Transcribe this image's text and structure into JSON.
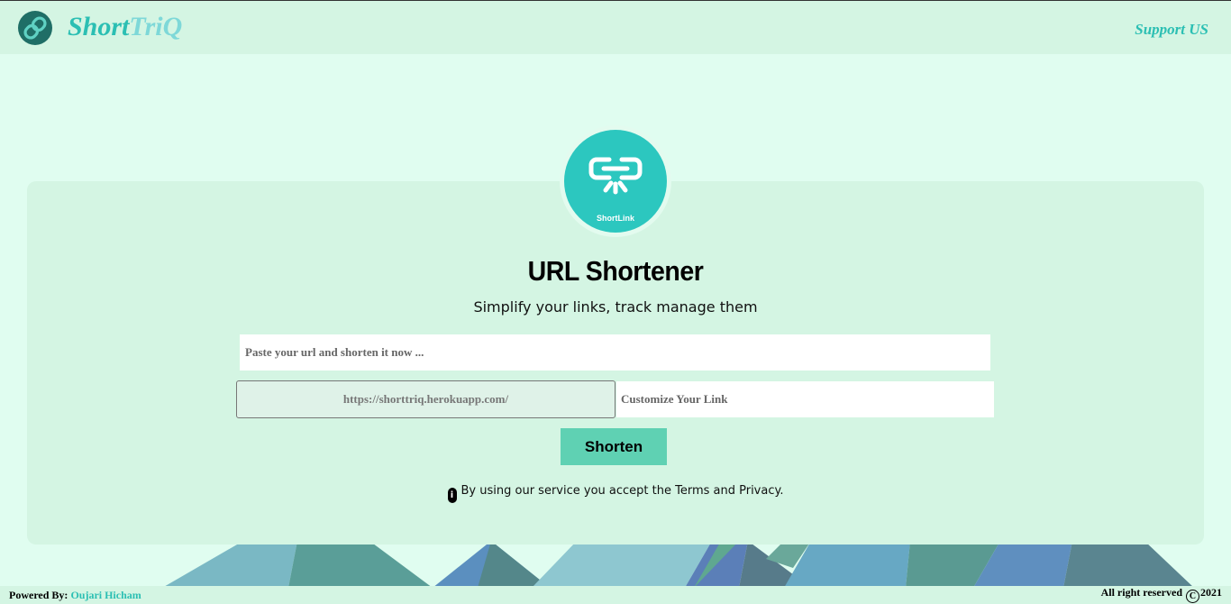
{
  "header": {
    "brand_part1": "Short",
    "brand_part2": "TriQ",
    "support_label": "Support US",
    "logo_icon": "chain-link-icon"
  },
  "hero": {
    "logo_caption": "ShortLink",
    "logo_icon": "chain-link-icon",
    "title": "URL Shortener",
    "subtitle": "Simplify your links, track manage them"
  },
  "form": {
    "url_placeholder": "Paste your url and shorten it now ...",
    "url_value": "",
    "domain_prefix": "https://shorttriq.herokuapp.com/",
    "custom_placeholder": "Customize Your Link",
    "custom_value": "",
    "submit_label": "Shorten"
  },
  "notice": {
    "icon": "info-icon",
    "text": "By using our service you accept the Terms and Privacy."
  },
  "footer": {
    "powered_label": "Powered By:",
    "author": "Oujari Hicham",
    "rights": "All right reserved",
    "year": "2021"
  },
  "colors": {
    "page_background": "#e0fdf0",
    "panel_background": "#d4f5e3",
    "accent": "#2bbfb3",
    "button": "#5fd1b3"
  }
}
